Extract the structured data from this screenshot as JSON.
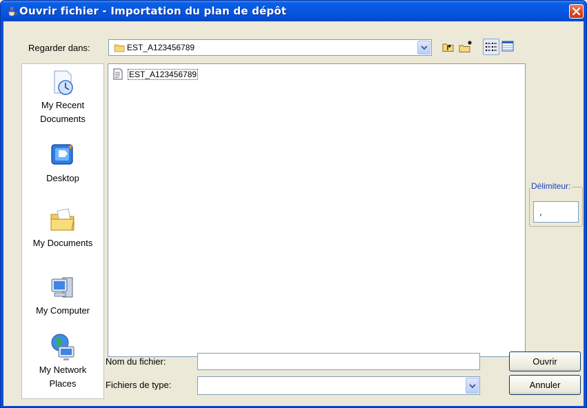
{
  "window": {
    "title": "Ouvrir fichier - Importation du plan de dépôt",
    "title_icon": "java-cup-icon",
    "close_icon": "close-icon"
  },
  "toolbar": {
    "look_in_label": "Regarder dans:",
    "look_in_value": "EST_A123456789",
    "buttons": [
      "up-folder-icon",
      "new-folder-icon",
      "list-view-icon",
      "details-view-icon"
    ]
  },
  "places": [
    {
      "label_lines": [
        "My Recent",
        "Documents"
      ],
      "icon": "recent-documents-icon"
    },
    {
      "label_lines": [
        "Desktop"
      ],
      "icon": "desktop-icon"
    },
    {
      "label_lines": [
        "My Documents"
      ],
      "icon": "my-documents-icon"
    },
    {
      "label_lines": [
        "My Computer"
      ],
      "icon": "my-computer-icon"
    },
    {
      "label_lines": [
        "My Network",
        "Places"
      ],
      "icon": "network-places-icon"
    }
  ],
  "files": [
    {
      "name": "EST_A123456789",
      "icon": "file-icon"
    }
  ],
  "delimiter": {
    "label": "Délimiteur:",
    "value": ","
  },
  "file_name": {
    "label": "Nom du fichier:",
    "value": ""
  },
  "file_type": {
    "label": "Fichiers de type:",
    "value": ""
  },
  "buttons": {
    "open": "Ouvrir",
    "cancel": "Annuler"
  },
  "colors": {
    "titlebar": "#0757e0",
    "dialog_bg": "#ece9d8",
    "field_border": "#7f9db9",
    "close_button": "#d6431c"
  }
}
